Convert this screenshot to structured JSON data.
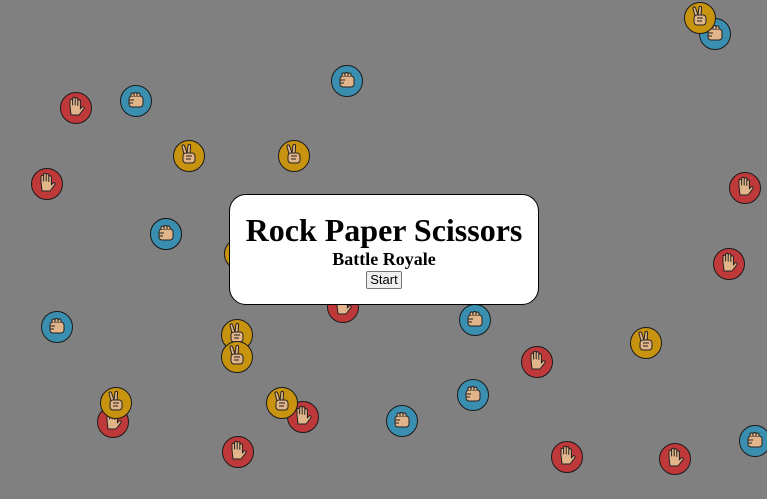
{
  "dialog": {
    "title": "Rock Paper Scissors",
    "subtitle": "Battle Royale",
    "start_label": "Start"
  },
  "colors": {
    "background": "#808080",
    "rock": "#3a8fb0",
    "paper": "#c0393a",
    "scissors": "#c8930f",
    "skin": "#e2b48a"
  },
  "icons": {
    "rock": "fist-icon",
    "paper": "open-hand-icon",
    "scissors": "victory-hand-icon"
  },
  "tokens": [
    {
      "type": "rock"
    },
    {
      "type": "scissors"
    },
    {
      "type": "rock"
    },
    {
      "type": "paper"
    },
    {
      "type": "rock"
    },
    {
      "type": "scissors"
    },
    {
      "type": "scissors"
    },
    {
      "type": "paper"
    },
    {
      "type": "paper"
    },
    {
      "type": "rock"
    },
    {
      "type": "scissors"
    },
    {
      "type": "paper"
    },
    {
      "type": "rock"
    },
    {
      "type": "paper"
    },
    {
      "type": "rock"
    },
    {
      "type": "scissors"
    },
    {
      "type": "scissors"
    },
    {
      "type": "scissors"
    },
    {
      "type": "paper"
    },
    {
      "type": "rock"
    },
    {
      "type": "paper"
    },
    {
      "type": "paper"
    },
    {
      "type": "scissors"
    },
    {
      "type": "scissors"
    },
    {
      "type": "paper"
    },
    {
      "type": "rock"
    },
    {
      "type": "rock"
    },
    {
      "type": "paper"
    },
    {
      "type": "paper"
    },
    {
      "type": "scissors"
    },
    {
      "type": "rock"
    }
  ]
}
